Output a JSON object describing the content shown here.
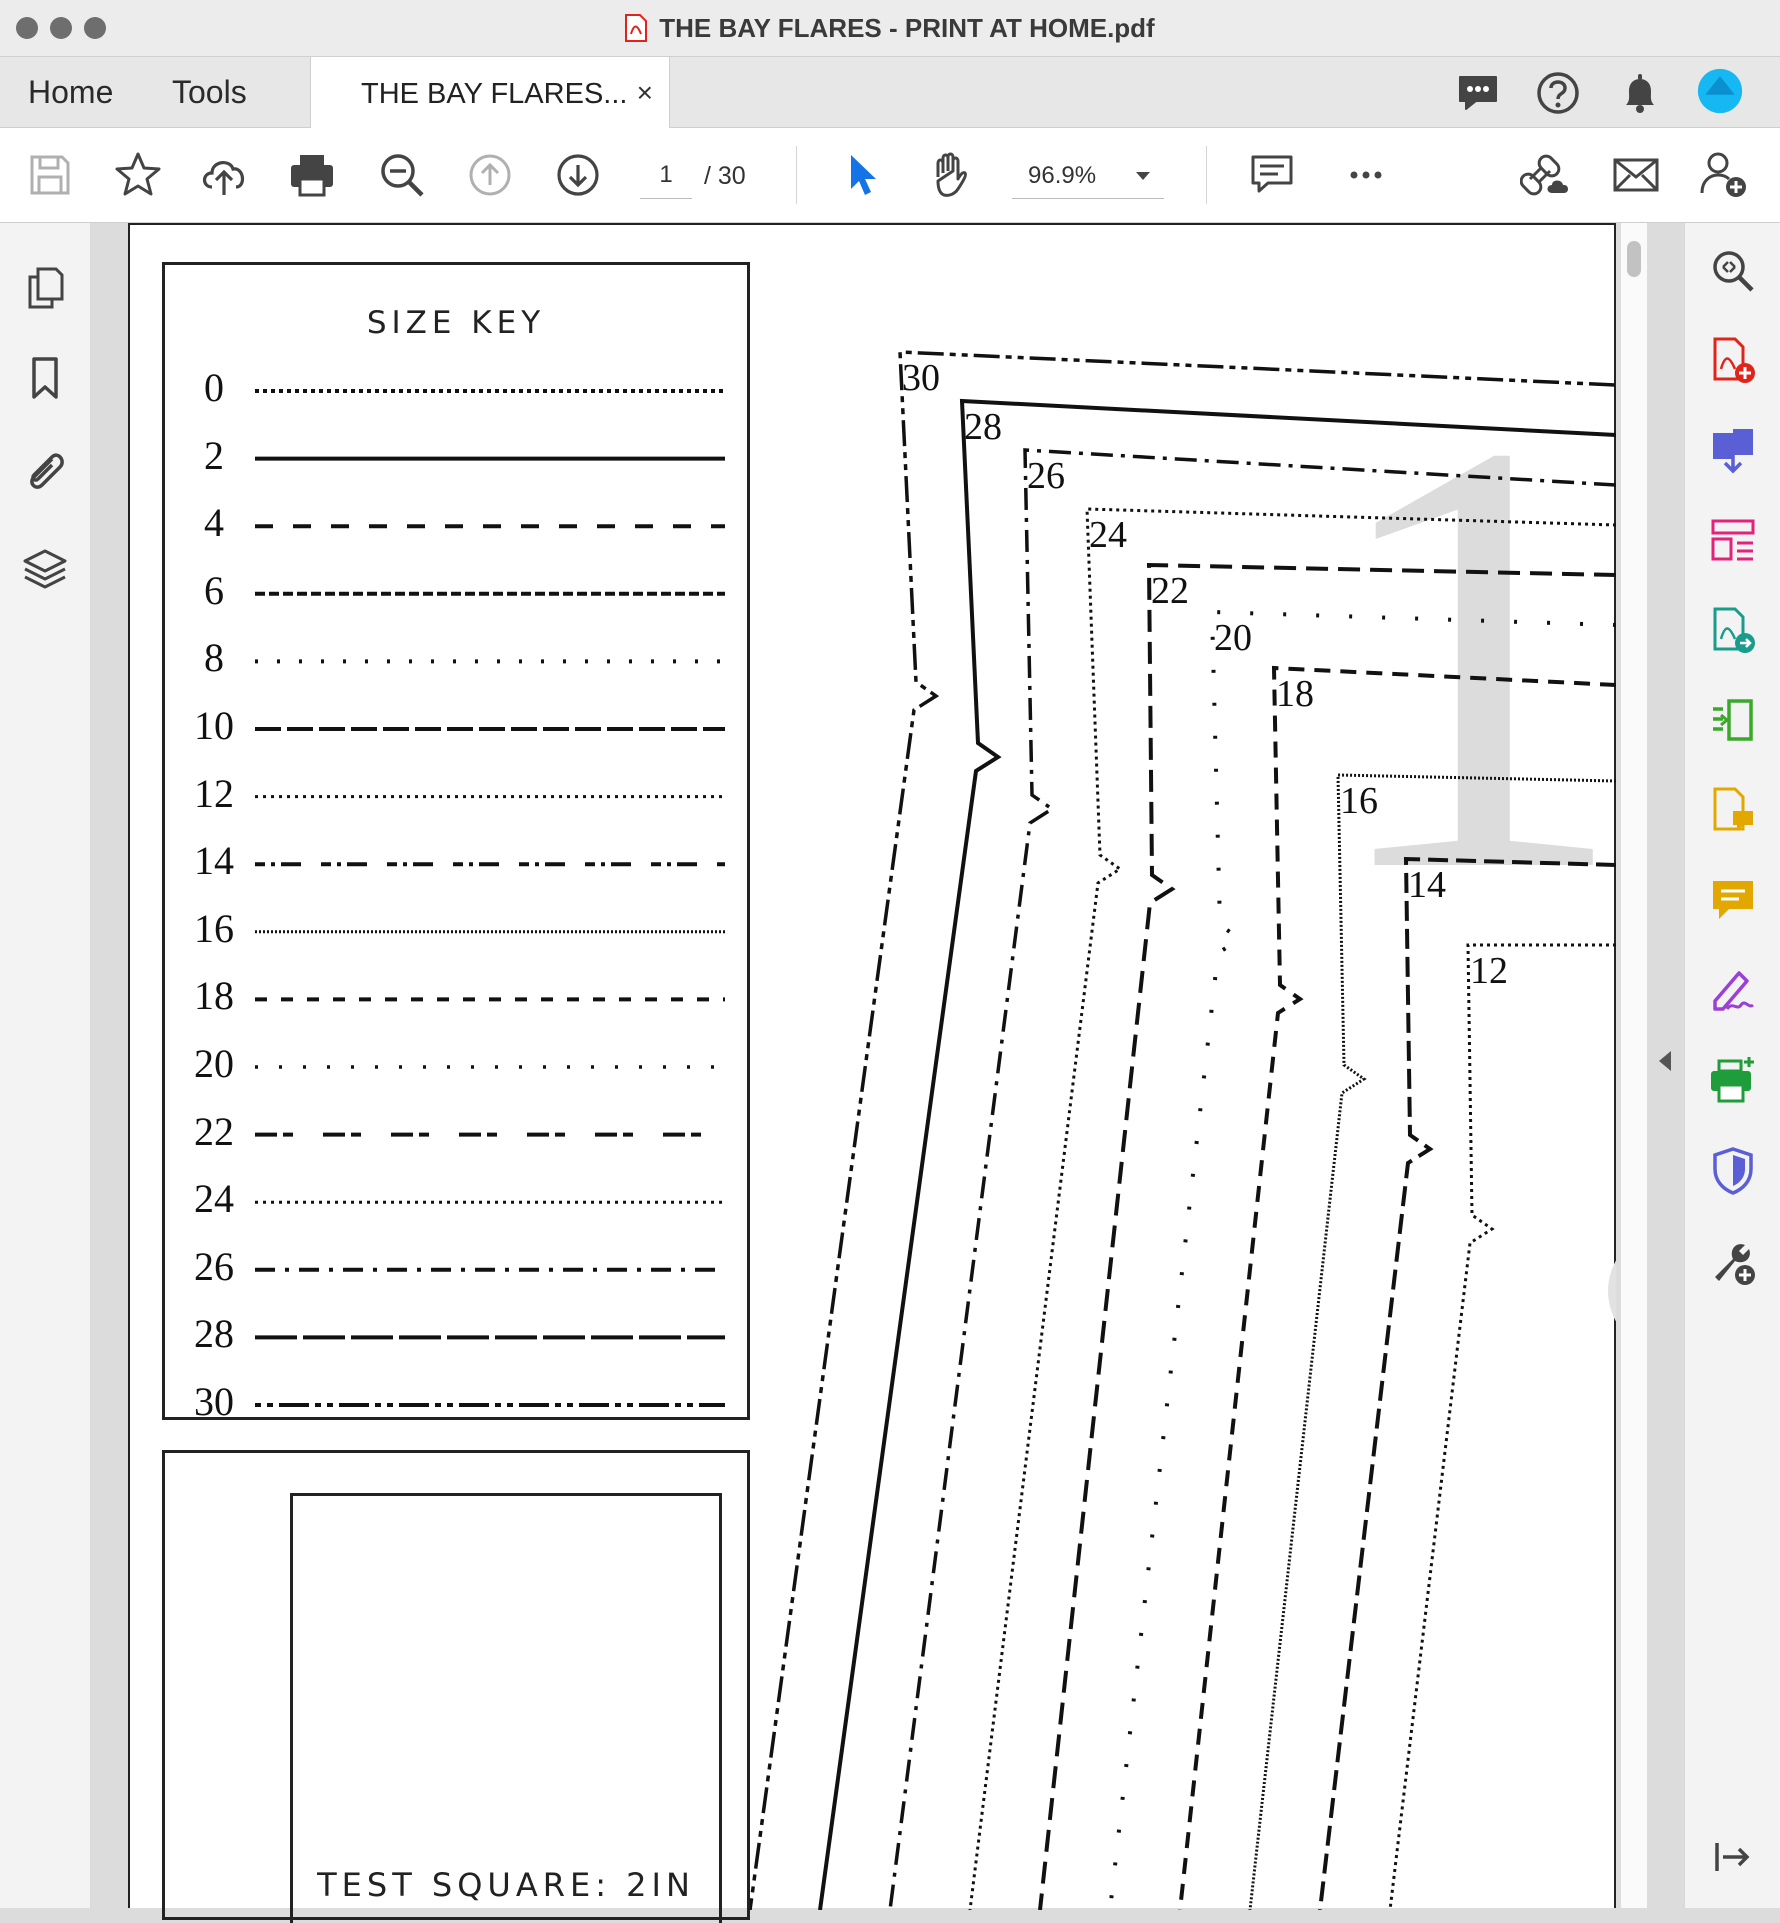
{
  "window": {
    "title": "THE BAY FLARES - PRINT AT HOME.pdf"
  },
  "tabs": {
    "home": "Home",
    "tools": "Tools",
    "document": "THE BAY FLARES...",
    "close": "×"
  },
  "toolbar": {
    "page_current": "1",
    "page_total": "/ 30",
    "zoom": "96.9%"
  },
  "icons": {
    "toolbar": [
      "save-icon",
      "star-icon",
      "upload-cloud-icon",
      "print-icon",
      "zoom-out-icon",
      "page-up-icon",
      "page-down-icon",
      "select-arrow-icon",
      "hand-icon",
      "comment-icon",
      "more-icon",
      "share-link-icon",
      "email-icon",
      "add-user-icon"
    ],
    "header": [
      "chat-icon",
      "help-icon",
      "bell-icon",
      "profile-icon"
    ],
    "left_rail": [
      "pages-icon",
      "bookmark-icon",
      "attachment-icon",
      "layers-icon"
    ],
    "right_rail": [
      "zoom-search-icon",
      "create-pdf-icon",
      "combine-files-icon",
      "organize-pages-icon",
      "export-pdf-icon",
      "compress-icon",
      "edit-pdf-icon",
      "comment-tool-icon",
      "fill-sign-icon",
      "print-production-icon",
      "protect-icon",
      "more-tools-icon",
      "collapse-panel-icon"
    ]
  },
  "colors": {
    "accent_blue": "#1473e6",
    "pdf_red": "#e0241b",
    "profile_cyan": "#16b8f3"
  },
  "document": {
    "size_key": {
      "title": "SIZE KEY",
      "sizes": [
        "0",
        "2",
        "4",
        "6",
        "8",
        "10",
        "12",
        "14",
        "16",
        "18",
        "20",
        "22",
        "24",
        "26",
        "28",
        "30"
      ]
    },
    "test_square": {
      "label": "TEST SQUARE: 2IN"
    },
    "pattern": {
      "page_number": "1",
      "size_labels": [
        "30",
        "28",
        "26",
        "24",
        "22",
        "20",
        "18",
        "16",
        "14",
        "12"
      ]
    }
  }
}
